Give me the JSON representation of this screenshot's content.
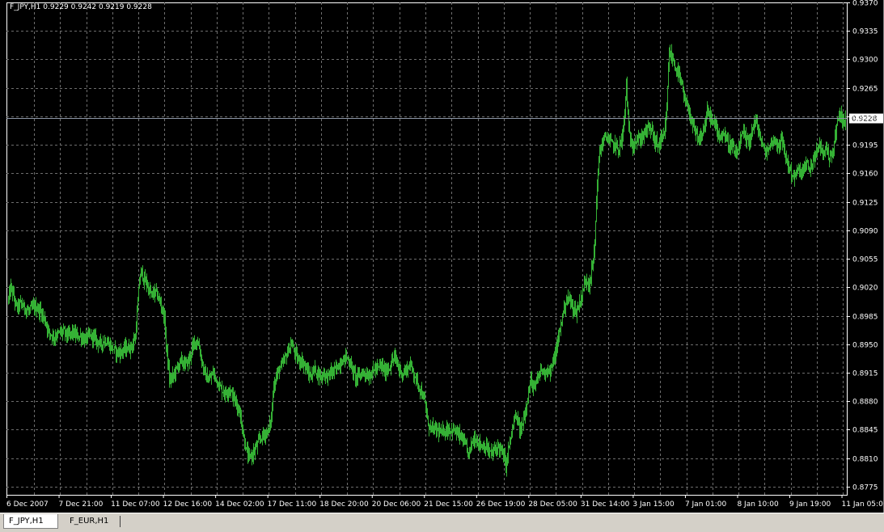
{
  "window": {
    "symbol_info": "F_JPY,H1  0.9229 0.9242 0.9219 0.9228"
  },
  "tabs": [
    {
      "label": "F_JPY,H1",
      "active": true
    },
    {
      "label": "F_EUR,H1",
      "active": false
    }
  ],
  "colors": {
    "background": "#000000",
    "grid": "#6e6e6e",
    "bars": "#35b135",
    "price_line": "#8c96a6",
    "price_label_bg": "#ffffff",
    "price_label_text": "#000000",
    "axis_text": "#ffffff"
  },
  "chart_data": {
    "type": "bar",
    "symbol": "F_JPY",
    "timeframe": "H1",
    "ohlc_last": {
      "open": 0.9229,
      "high": 0.9242,
      "low": 0.9219,
      "close": 0.9228
    },
    "current_price": "0.9228",
    "ylim": [
      0.8765,
      0.937
    ],
    "y_ticks": [
      "0.9370",
      "0.9335",
      "0.9300",
      "0.9265",
      "0.9230",
      "0.9195",
      "0.9160",
      "0.9125",
      "0.9090",
      "0.9055",
      "0.9020",
      "0.8985",
      "0.8950",
      "0.8915",
      "0.8880",
      "0.8845",
      "0.8810",
      "0.8775"
    ],
    "x_ticks": [
      "6 Dec 2007",
      "7 Dec 21:00",
      "11 Dec 07:00",
      "12 Dec 16:00",
      "14 Dec 02:00",
      "17 Dec 11:00",
      "18 Dec 20:00",
      "20 Dec 06:00",
      "21 Dec 15:00",
      "26 Dec 19:00",
      "28 Dec 05:00",
      "31 Dec 14:00",
      "3 Jan 15:00",
      "7 Jan 01:00",
      "8 Jan 10:00",
      "9 Jan 19:00",
      "11 Jan 05:00"
    ],
    "grid": true,
    "series_anchors": [
      [
        0,
        0.9005
      ],
      [
        3,
        0.902
      ],
      [
        6,
        0.901
      ],
      [
        10,
        0.8995
      ],
      [
        15,
        0.9
      ],
      [
        20,
        0.8995
      ],
      [
        25,
        0.899
      ],
      [
        30,
        0.8995
      ],
      [
        35,
        0.8995
      ],
      [
        40,
        0.899
      ],
      [
        45,
        0.898
      ],
      [
        50,
        0.8965
      ],
      [
        55,
        0.896
      ],
      [
        60,
        0.896
      ],
      [
        65,
        0.8965
      ],
      [
        70,
        0.8965
      ],
      [
        75,
        0.896
      ],
      [
        80,
        0.8965
      ],
      [
        85,
        0.896
      ],
      [
        90,
        0.896
      ],
      [
        95,
        0.8955
      ],
      [
        100,
        0.896
      ],
      [
        105,
        0.896
      ],
      [
        110,
        0.8955
      ],
      [
        115,
        0.895
      ],
      [
        120,
        0.8955
      ],
      [
        125,
        0.895
      ],
      [
        130,
        0.8945
      ],
      [
        135,
        0.894
      ],
      [
        140,
        0.894
      ],
      [
        145,
        0.8945
      ],
      [
        150,
        0.8945
      ],
      [
        155,
        0.895
      ],
      [
        158,
        0.896
      ],
      [
        161,
        0.9
      ],
      [
        163,
        0.903
      ],
      [
        166,
        0.904
      ],
      [
        168,
        0.903
      ],
      [
        172,
        0.9025
      ],
      [
        176,
        0.9015
      ],
      [
        180,
        0.901
      ],
      [
        184,
        0.9015
      ],
      [
        188,
        0.9005
      ],
      [
        192,
        0.8995
      ],
      [
        195,
        0.898
      ],
      [
        197,
        0.895
      ],
      [
        199,
        0.893
      ],
      [
        201,
        0.8905
      ],
      [
        205,
        0.891
      ],
      [
        210,
        0.892
      ],
      [
        215,
        0.893
      ],
      [
        220,
        0.8925
      ],
      [
        225,
        0.893
      ],
      [
        228,
        0.894
      ],
      [
        231,
        0.895
      ],
      [
        234,
        0.8955
      ],
      [
        237,
        0.895
      ],
      [
        240,
        0.8935
      ],
      [
        243,
        0.892
      ],
      [
        246,
        0.891
      ],
      [
        250,
        0.8905
      ],
      [
        255,
        0.8915
      ],
      [
        260,
        0.8905
      ],
      [
        265,
        0.8895
      ],
      [
        270,
        0.889
      ],
      [
        275,
        0.8895
      ],
      [
        280,
        0.8885
      ],
      [
        285,
        0.8875
      ],
      [
        290,
        0.886
      ],
      [
        294,
        0.8835
      ],
      [
        297,
        0.882
      ],
      [
        300,
        0.881
      ],
      [
        305,
        0.8815
      ],
      [
        310,
        0.8825
      ],
      [
        315,
        0.8835
      ],
      [
        320,
        0.884
      ],
      [
        325,
        0.8845
      ],
      [
        328,
        0.886
      ],
      [
        331,
        0.89
      ],
      [
        334,
        0.891
      ],
      [
        338,
        0.892
      ],
      [
        342,
        0.8925
      ],
      [
        346,
        0.8935
      ],
      [
        350,
        0.8945
      ],
      [
        353,
        0.895
      ],
      [
        357,
        0.894
      ],
      [
        361,
        0.893
      ],
      [
        365,
        0.893
      ],
      [
        369,
        0.8925
      ],
      [
        373,
        0.8915
      ],
      [
        377,
        0.891
      ],
      [
        381,
        0.892
      ],
      [
        385,
        0.8915
      ],
      [
        389,
        0.891
      ],
      [
        393,
        0.8915
      ],
      [
        397,
        0.891
      ],
      [
        401,
        0.8915
      ],
      [
        405,
        0.8915
      ],
      [
        409,
        0.892
      ],
      [
        413,
        0.8925
      ],
      [
        417,
        0.893
      ],
      [
        421,
        0.8935
      ],
      [
        425,
        0.893
      ],
      [
        429,
        0.892
      ],
      [
        433,
        0.891
      ],
      [
        437,
        0.891
      ],
      [
        441,
        0.8915
      ],
      [
        445,
        0.8915
      ],
      [
        449,
        0.891
      ],
      [
        453,
        0.8915
      ],
      [
        457,
        0.892
      ],
      [
        461,
        0.892
      ],
      [
        465,
        0.8925
      ],
      [
        469,
        0.8915
      ],
      [
        473,
        0.892
      ],
      [
        477,
        0.8925
      ],
      [
        481,
        0.8935
      ],
      [
        485,
        0.8925
      ],
      [
        489,
        0.8915
      ],
      [
        493,
        0.8915
      ],
      [
        497,
        0.892
      ],
      [
        501,
        0.8925
      ],
      [
        505,
        0.8915
      ],
      [
        509,
        0.8905
      ],
      [
        513,
        0.8895
      ],
      [
        517,
        0.8885
      ],
      [
        521,
        0.8865
      ],
      [
        525,
        0.885
      ],
      [
        530,
        0.8845
      ],
      [
        535,
        0.8845
      ],
      [
        540,
        0.884
      ],
      [
        545,
        0.8845
      ],
      [
        550,
        0.8845
      ],
      [
        555,
        0.8845
      ],
      [
        560,
        0.884
      ],
      [
        565,
        0.8835
      ],
      [
        570,
        0.8825
      ],
      [
        574,
        0.8815
      ],
      [
        578,
        0.883
      ],
      [
        582,
        0.8835
      ],
      [
        586,
        0.883
      ],
      [
        590,
        0.8825
      ],
      [
        594,
        0.8825
      ],
      [
        598,
        0.882
      ],
      [
        602,
        0.8815
      ],
      [
        606,
        0.882
      ],
      [
        610,
        0.8825
      ],
      [
        614,
        0.882
      ],
      [
        618,
        0.881
      ],
      [
        620,
        0.88
      ],
      [
        623,
        0.882
      ],
      [
        627,
        0.884
      ],
      [
        631,
        0.886
      ],
      [
        635,
        0.8855
      ],
      [
        639,
        0.884
      ],
      [
        642,
        0.8855
      ],
      [
        645,
        0.887
      ],
      [
        648,
        0.8885
      ],
      [
        652,
        0.8905
      ],
      [
        656,
        0.8895
      ],
      [
        660,
        0.8905
      ],
      [
        664,
        0.892
      ],
      [
        668,
        0.8915
      ],
      [
        672,
        0.892
      ],
      [
        676,
        0.8915
      ],
      [
        680,
        0.893
      ],
      [
        684,
        0.8945
      ],
      [
        688,
        0.897
      ],
      [
        692,
        0.899
      ],
      [
        696,
        0.9005
      ],
      [
        700,
        0.9005
      ],
      [
        704,
        0.8995
      ],
      [
        708,
        0.899
      ],
      [
        712,
        0.9
      ],
      [
        716,
        0.9015
      ],
      [
        720,
        0.903
      ],
      [
        724,
        0.9025
      ],
      [
        727,
        0.904
      ],
      [
        730,
        0.906
      ],
      [
        732,
        0.91
      ],
      [
        734,
        0.915
      ],
      [
        737,
        0.9185
      ],
      [
        741,
        0.92
      ],
      [
        745,
        0.9205
      ],
      [
        749,
        0.92
      ],
      [
        753,
        0.9195
      ],
      [
        757,
        0.9195
      ],
      [
        761,
        0.919
      ],
      [
        765,
        0.92
      ],
      [
        768,
        0.922
      ],
      [
        771,
        0.927
      ],
      [
        774,
        0.921
      ],
      [
        778,
        0.9195
      ],
      [
        782,
        0.92
      ],
      [
        786,
        0.92
      ],
      [
        790,
        0.9205
      ],
      [
        794,
        0.921
      ],
      [
        798,
        0.9215
      ],
      [
        802,
        0.9215
      ],
      [
        806,
        0.92
      ],
      [
        810,
        0.9195
      ],
      [
        814,
        0.92
      ],
      [
        818,
        0.9205
      ],
      [
        821,
        0.924
      ],
      [
        824,
        0.931
      ],
      [
        828,
        0.93
      ],
      [
        832,
        0.929
      ],
      [
        836,
        0.928
      ],
      [
        840,
        0.9265
      ],
      [
        844,
        0.9245
      ],
      [
        848,
        0.924
      ],
      [
        852,
        0.922
      ],
      [
        856,
        0.921
      ],
      [
        860,
        0.92
      ],
      [
        864,
        0.9205
      ],
      [
        868,
        0.922
      ],
      [
        872,
        0.9235
      ],
      [
        876,
        0.923
      ],
      [
        880,
        0.922
      ],
      [
        884,
        0.9215
      ],
      [
        888,
        0.9205
      ],
      [
        892,
        0.921
      ],
      [
        896,
        0.92
      ],
      [
        900,
        0.9195
      ],
      [
        904,
        0.919
      ],
      [
        908,
        0.918
      ],
      [
        912,
        0.9195
      ],
      [
        916,
        0.921
      ],
      [
        920,
        0.92
      ],
      [
        924,
        0.92
      ],
      [
        928,
        0.9215
      ],
      [
        932,
        0.9225
      ],
      [
        936,
        0.921
      ],
      [
        940,
        0.9195
      ],
      [
        944,
        0.9185
      ],
      [
        948,
        0.919
      ],
      [
        952,
        0.92
      ],
      [
        956,
        0.92
      ],
      [
        960,
        0.9195
      ],
      [
        964,
        0.92
      ],
      [
        968,
        0.9185
      ],
      [
        972,
        0.917
      ],
      [
        976,
        0.916
      ],
      [
        980,
        0.9155
      ],
      [
        984,
        0.9165
      ],
      [
        988,
        0.916
      ],
      [
        992,
        0.9165
      ],
      [
        996,
        0.917
      ],
      [
        1000,
        0.9165
      ],
      [
        1004,
        0.9175
      ],
      [
        1008,
        0.9185
      ],
      [
        1012,
        0.9195
      ],
      [
        1016,
        0.9185
      ],
      [
        1020,
        0.919
      ],
      [
        1024,
        0.918
      ],
      [
        1028,
        0.9185
      ],
      [
        1032,
        0.921
      ],
      [
        1036,
        0.9235
      ],
      [
        1040,
        0.9225
      ],
      [
        1044,
        0.9228
      ]
    ]
  }
}
